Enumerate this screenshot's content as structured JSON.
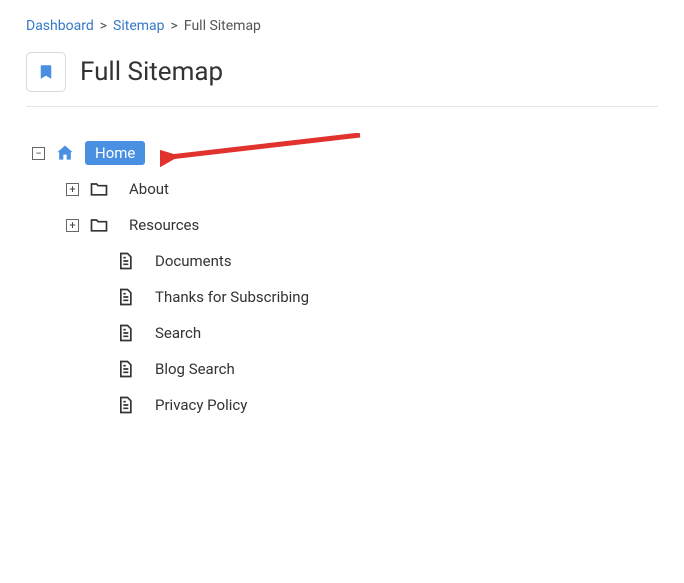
{
  "breadcrumb": {
    "items": [
      "Dashboard",
      "Sitemap",
      "Full Sitemap"
    ]
  },
  "page": {
    "title": "Full Sitemap"
  },
  "tree": {
    "root": {
      "label": "Home"
    },
    "children": [
      {
        "label": "About"
      },
      {
        "label": "Resources"
      },
      {
        "label": "Documents"
      },
      {
        "label": "Thanks for Subscribing"
      },
      {
        "label": "Search"
      },
      {
        "label": "Blog Search"
      },
      {
        "label": "Privacy Policy"
      }
    ]
  },
  "expander": {
    "minus": "−",
    "plus": "+"
  }
}
